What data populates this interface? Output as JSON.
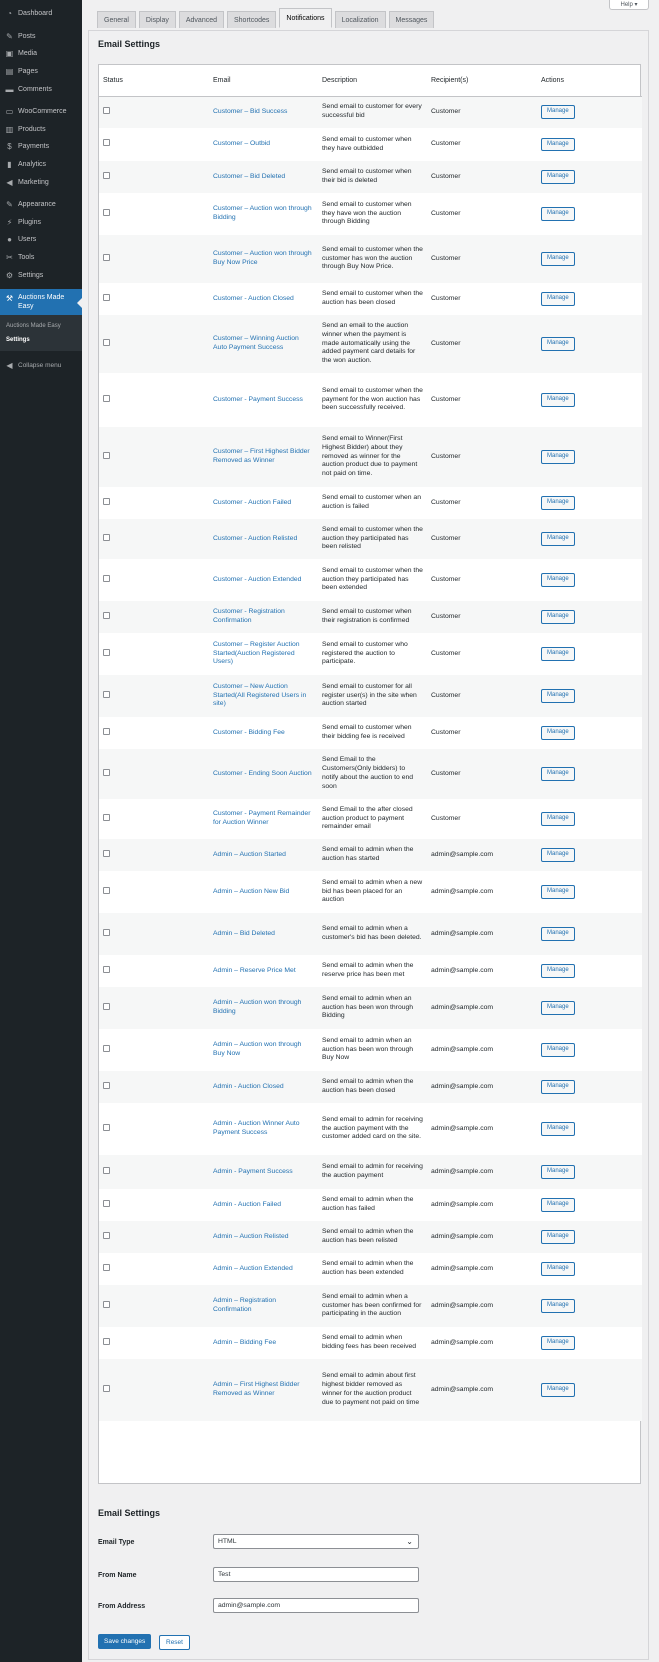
{
  "sidebar": {
    "items": [
      {
        "label": "Dashboard",
        "icon": "dashboard-icon",
        "glyph": "◔"
      },
      {
        "label": "Posts",
        "icon": "pin-icon",
        "glyph": "✎"
      },
      {
        "label": "Media",
        "icon": "media-icon",
        "glyph": "▣"
      },
      {
        "label": "Pages",
        "icon": "pages-icon",
        "glyph": "▤"
      },
      {
        "label": "Comments",
        "icon": "comments-icon",
        "glyph": "▬"
      },
      {
        "label": "WooCommerce",
        "icon": "woocommerce-icon",
        "glyph": "▭"
      },
      {
        "label": "Products",
        "icon": "products-icon",
        "glyph": "▥"
      },
      {
        "label": "Payments",
        "icon": "payments-icon",
        "glyph": "$"
      },
      {
        "label": "Analytics",
        "icon": "analytics-icon",
        "glyph": "▮"
      },
      {
        "label": "Marketing",
        "icon": "marketing-icon",
        "glyph": "◀"
      },
      {
        "label": "Appearance",
        "icon": "appearance-icon",
        "glyph": "✎"
      },
      {
        "label": "Plugins",
        "icon": "plugins-icon",
        "glyph": "⚡"
      },
      {
        "label": "Users",
        "icon": "users-icon",
        "glyph": "●"
      },
      {
        "label": "Tools",
        "icon": "tools-icon",
        "glyph": "✂"
      },
      {
        "label": "Settings",
        "icon": "settings-icon",
        "glyph": "⚙"
      }
    ],
    "current": {
      "label": "Auctions Made Easy",
      "icon": "hammer-icon",
      "glyph": "⚒"
    },
    "submenu": [
      {
        "label": "Auctions Made Easy",
        "active": false
      },
      {
        "label": "Settings",
        "active": true
      }
    ],
    "collapse_label": "Collapse menu"
  },
  "help_label": "Help ▾",
  "tabs": [
    {
      "label": "General",
      "active": false
    },
    {
      "label": "Display",
      "active": false
    },
    {
      "label": "Advanced",
      "active": false
    },
    {
      "label": "Shortcodes",
      "active": false
    },
    {
      "label": "Notifications",
      "active": true
    },
    {
      "label": "Localization",
      "active": false
    },
    {
      "label": "Messages",
      "active": false
    }
  ],
  "section_title": "Email Settings",
  "table": {
    "headers": [
      "Status",
      "Email",
      "Description",
      "Recipient(s)",
      "Actions"
    ],
    "manage_label": "Manage",
    "rows": [
      {
        "email": "Customer – Bid Success",
        "description": "Send email to customer for every successful bid",
        "recipient": "Customer"
      },
      {
        "email": "Customer – Outbid",
        "description": "Send email to customer when they have outbidded",
        "recipient": "Customer"
      },
      {
        "email": "Customer – Bid Deleted",
        "description": "Send email to customer when their bid is deleted",
        "recipient": "Customer"
      },
      {
        "email": "Customer – Auction won through Bidding",
        "description": "Send email to customer when they have won the auction through Bidding",
        "recipient": "Customer"
      },
      {
        "email": "Customer – Auction won through Buy Now Price",
        "description": "Send email to customer when the customer has won the auction through Buy Now Price.",
        "recipient": "Customer"
      },
      {
        "email": "Customer - Auction Closed",
        "description": "Send email to customer when the auction has been closed",
        "recipient": "Customer"
      },
      {
        "email": "Customer – Winning Auction Auto Payment Success",
        "description": "Send an email to the auction winner when the payment is made automatically using the added payment card details for the won auction.",
        "recipient": "Customer"
      },
      {
        "email": "Customer - Payment Success",
        "description": "Send email to customer when the payment for the won auction has been successfully received.",
        "recipient": "Customer"
      },
      {
        "email": "Customer – First Highest Bidder Removed as Winner",
        "description": "Send email to Winner(First Highest Bidder) about they removed as winner for the auction product due to payment not paid on time.",
        "recipient": "Customer"
      },
      {
        "email": "Customer - Auction Failed",
        "description": "Send email to customer when an auction is failed",
        "recipient": "Customer"
      },
      {
        "email": "Customer - Auction Relisted",
        "description": "Send email to customer when the auction they participated has been relisted",
        "recipient": "Customer"
      },
      {
        "email": "Customer - Auction Extended",
        "description": "Send email to customer when the auction they participated has been extended",
        "recipient": "Customer"
      },
      {
        "email": "Customer - Registration Confirmation",
        "description": "Send email to customer when their registration is confirmed",
        "recipient": "Customer"
      },
      {
        "email": "Customer – Register Auction Started(Auction Registered Users)",
        "description": "Send email to customer who registered the auction to participate.",
        "recipient": "Customer"
      },
      {
        "email": "Customer – New Auction Started(All Registered Users in site)",
        "description": "Send email to customer for all register user(s) in the site when auction started",
        "recipient": "Customer"
      },
      {
        "email": "Customer - Bidding Fee",
        "description": "Send email to customer when their bidding fee is received",
        "recipient": "Customer"
      },
      {
        "email": "Customer - Ending Soon Auction",
        "description": "Send Email to the Customers(Only bidders) to notify about the auction to end soon",
        "recipient": "Customer"
      },
      {
        "email": "Customer - Payment Remainder for Auction Winner",
        "description": "Send Email to the after closed auction product to payment remainder email",
        "recipient": "Customer"
      },
      {
        "email": "Admin – Auction Started",
        "description": "Send email to admin when the auction has started",
        "recipient": "admin@sample.com"
      },
      {
        "email": "Admin – Auction New Bid",
        "description": "Send email to admin when a new bid has been placed for an auction",
        "recipient": "admin@sample.com"
      },
      {
        "email": "Admin – Bid Deleted",
        "description": "Send email to admin when a customer's bid has been deleted.",
        "recipient": "admin@sample.com"
      },
      {
        "email": "Admin – Reserve Price Met",
        "description": "Send email to admin when the reserve price has been met",
        "recipient": "admin@sample.com"
      },
      {
        "email": "Admin – Auction won through Bidding",
        "description": "Send email to admin when an auction has been won through Bidding",
        "recipient": "admin@sample.com"
      },
      {
        "email": "Admin – Auction won through Buy Now",
        "description": "Send email to admin when an auction has been won through Buy Now",
        "recipient": "admin@sample.com"
      },
      {
        "email": "Admin - Auction Closed",
        "description": "Send email to admin when the auction has been closed",
        "recipient": "admin@sample.com"
      },
      {
        "email": "Admin - Auction Winner Auto Payment Success",
        "description": "Send email to admin for receiving the auction payment with the customer added card on the site.",
        "recipient": "admin@sample.com"
      },
      {
        "email": "Admin - Payment Success",
        "description": "Send email to admin for receiving the auction payment",
        "recipient": "admin@sample.com"
      },
      {
        "email": "Admin - Auction Failed",
        "description": "Send email to admin when the auction has failed",
        "recipient": "admin@sample.com"
      },
      {
        "email": "Admin – Auction Relisted",
        "description": "Send email to admin when the auction has been relisted",
        "recipient": "admin@sample.com"
      },
      {
        "email": "Admin – Auction Extended",
        "description": "Send email to admin when the auction has been extended",
        "recipient": "admin@sample.com"
      },
      {
        "email": "Admin – Registration Confirmation",
        "description": "Send email to admin when a customer has been confirmed for participating in the auction",
        "recipient": "admin@sample.com"
      },
      {
        "email": "Admin – Bidding Fee",
        "description": "Send email to admin when bidding fees has been received",
        "recipient": "admin@sample.com"
      },
      {
        "email": "Admin – First Highest Bidder Removed as Winner",
        "description": "Send email to admin about first highest bidder removed as winner for the auction product due to payment not paid on time",
        "recipient": "admin@sample.com"
      }
    ]
  },
  "settings_form": {
    "title": "Email Settings",
    "email_type": {
      "label": "Email Type",
      "value": "HTML"
    },
    "from_name": {
      "label": "From Name",
      "value": "Test"
    },
    "from_address": {
      "label": "From Address",
      "value": "admin@sample.com"
    },
    "save_label": "Save changes",
    "reset_label": "Reset"
  },
  "colors": {
    "accent": "#2271b1",
    "sidebar_bg": "#1d2327"
  }
}
